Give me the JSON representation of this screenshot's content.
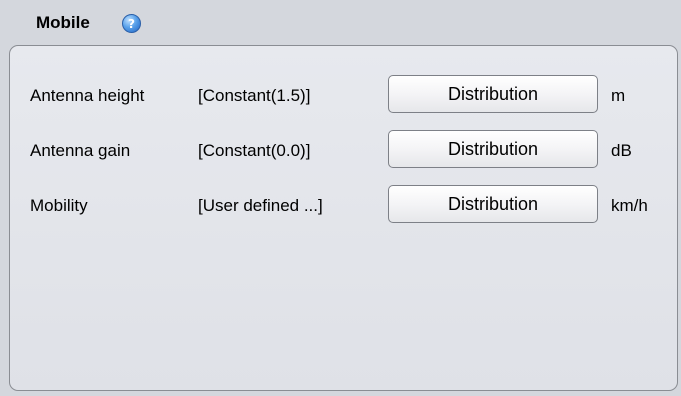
{
  "section": {
    "title": "Mobile",
    "help_icon": "help-icon"
  },
  "rows": [
    {
      "label": "Antenna height",
      "value": "[Constant(1.5)]",
      "button": "Distribution",
      "unit": "m"
    },
    {
      "label": "Antenna gain",
      "value": "[Constant(0.0)]",
      "button": "Distribution",
      "unit": "dB"
    },
    {
      "label": "Mobility",
      "value": "[User defined ...]",
      "button": "Distribution",
      "unit": "km/h"
    }
  ],
  "colors": {
    "background": "#d4d7dd",
    "panel": "#e4e6eb",
    "help_icon": "#3f86dc"
  }
}
